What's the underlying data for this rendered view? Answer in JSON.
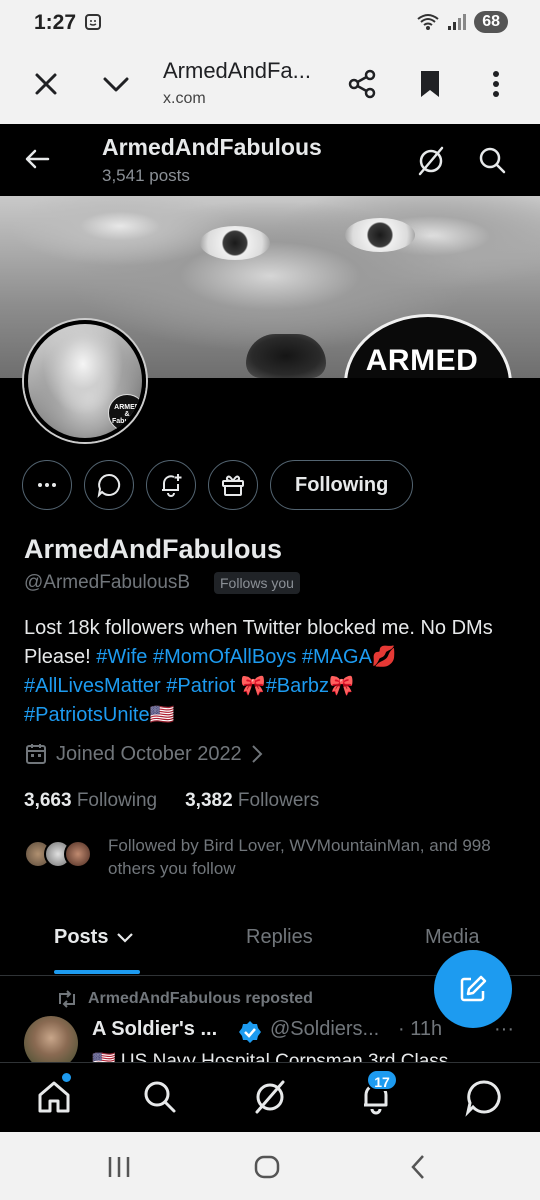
{
  "status_bar": {
    "time": "1:27",
    "battery": "68"
  },
  "browser": {
    "title": "ArmedAndFa...",
    "url": "x.com"
  },
  "header": {
    "name": "ArmedAndFabulous",
    "posts_count": "3,541 posts"
  },
  "banner": {
    "overlay_text": "ARMED"
  },
  "avatar": {
    "badge_text": "ARMED & Fabulous"
  },
  "actions": {
    "following_label": "Following"
  },
  "profile": {
    "display_name": "ArmedAndFabulous",
    "handle": "@ArmedFabulousB",
    "follows_you": "Follows you",
    "bio": {
      "text_1": "Lost 18k followers when Twitter blocked me. No DMs Please! ",
      "tag_wife": "#Wife",
      "tag_mom": "#MomOfAllBoys",
      "tag_maga": "#MAGA",
      "emoji_kiss": "💋",
      "tag_alm": "#AllLivesMatter",
      "tag_patriot": "#Patriot",
      "emoji_ribbon": "🎀",
      "tag_barbz": "#Barbz",
      "tag_united": "#PatriotsUnite",
      "emoji_flag": "🇺🇸"
    },
    "joined": "Joined October 2022",
    "following_count": "3,663",
    "following_label": "Following",
    "followers_count": "3,382",
    "followers_label": "Followers",
    "followed_by": "Followed by Bird Lover, WVMountainMan, and 998 others you follow"
  },
  "tabs": [
    {
      "label": "Posts"
    },
    {
      "label": "Replies"
    },
    {
      "label": "Media"
    }
  ],
  "post": {
    "repost_label": "ArmedAndFabulous reposted",
    "author_name": "A Soldier's ...",
    "author_handle": "@Soldiers...",
    "time": "· 11h",
    "more": "···",
    "text": "🇺🇸 US Navy Hospital Corpsman 3rd Class"
  },
  "bottom_nav": {
    "notifications_badge": "17"
  },
  "colors": {
    "accent": "#1d9bf0",
    "background": "#000000",
    "muted": "#71767b",
    "text": "#e7e9ea"
  }
}
